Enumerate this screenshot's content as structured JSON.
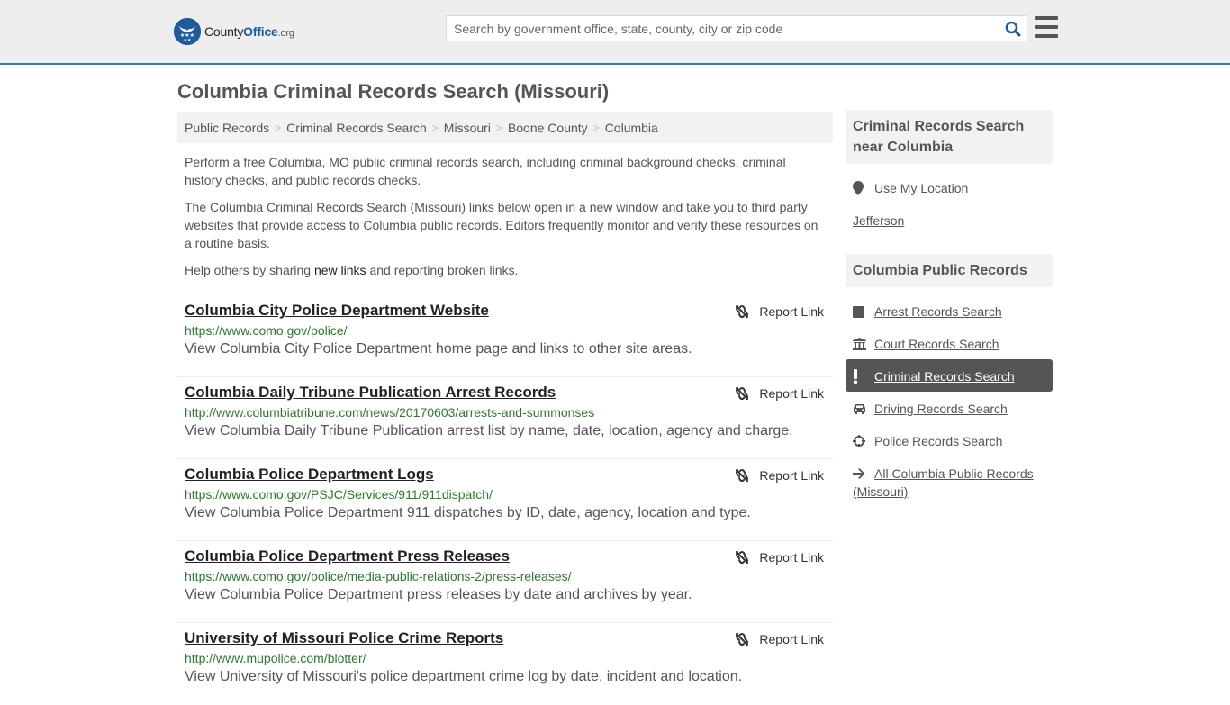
{
  "header": {
    "logo": {
      "brand_a": "County",
      "brand_b": "Office",
      "tld": ".org"
    },
    "search": {
      "placeholder": "Search by government office, state, county, city or zip code",
      "value": ""
    },
    "colors": {
      "brand": "#1e5b9c",
      "header_border": "#3a7bab",
      "url_green": "#2d7a2d"
    }
  },
  "page": {
    "title": "Columbia Criminal Records Search (Missouri)"
  },
  "breadcrumb": [
    {
      "label": "Public Records"
    },
    {
      "label": "Criminal Records Search"
    },
    {
      "label": "Missouri"
    },
    {
      "label": "Boone County"
    },
    {
      "label": "Columbia"
    }
  ],
  "intro": {
    "p1": "Perform a free Columbia, MO public criminal records search, including criminal background checks, criminal history checks, and public records checks.",
    "p2": "The Columbia Criminal Records Search (Missouri) links below open in a new window and take you to third party websites that provide access to Columbia public records. Editors frequently monitor and verify these resources on a routine basis.",
    "p3_before": "Help others by sharing ",
    "p3_link": "new links",
    "p3_after": " and reporting broken links."
  },
  "results": [
    {
      "title": "Columbia City Police Department Website",
      "url": "https://www.como.gov/police/",
      "desc": "View Columbia City Police Department home page and links to other site areas.",
      "report": "Report Link"
    },
    {
      "title": "Columbia Daily Tribune Publication Arrest Records",
      "url": "http://www.columbiatribune.com/news/20170603/arrests-and-summonses",
      "desc": "View Columbia Daily Tribune Publication arrest list by name, date, location, agency and charge.",
      "report": "Report Link"
    },
    {
      "title": "Columbia Police Department Logs",
      "url": "https://www.como.gov/PSJC/Services/911/911dispatch/",
      "desc": "View Columbia Police Department 911 dispatches by ID, date, agency, location and type.",
      "report": "Report Link"
    },
    {
      "title": "Columbia Police Department Press Releases",
      "url": "https://www.como.gov/police/media-public-relations-2/press-releases/",
      "desc": "View Columbia Police Department press releases by date and archives by year.",
      "report": "Report Link"
    },
    {
      "title": "University of Missouri Police Crime Reports",
      "url": "http://www.mupolice.com/blotter/",
      "desc": "View University of Missouri's police department crime log by date, incident and location.",
      "report": "Report Link"
    }
  ],
  "sidebar": {
    "nearby": {
      "heading": "Criminal Records Search near Columbia",
      "use_location": "Use My Location",
      "places": [
        "Jefferson"
      ]
    },
    "public_records": {
      "heading": "Columbia Public Records",
      "items": [
        {
          "label": "Arrest Records Search",
          "icon": "square-icon",
          "active": false
        },
        {
          "label": "Court Records Search",
          "icon": "courthouse-icon",
          "active": false
        },
        {
          "label": "Criminal Records Search",
          "icon": "exclamation-icon",
          "active": true
        },
        {
          "label": "Driving Records Search",
          "icon": "car-icon",
          "active": false
        },
        {
          "label": "Police Records Search",
          "icon": "crosshair-icon",
          "active": false
        },
        {
          "label": "All Columbia Public Records (Missouri)",
          "icon": "arrow-right-icon",
          "active": false
        }
      ]
    }
  }
}
